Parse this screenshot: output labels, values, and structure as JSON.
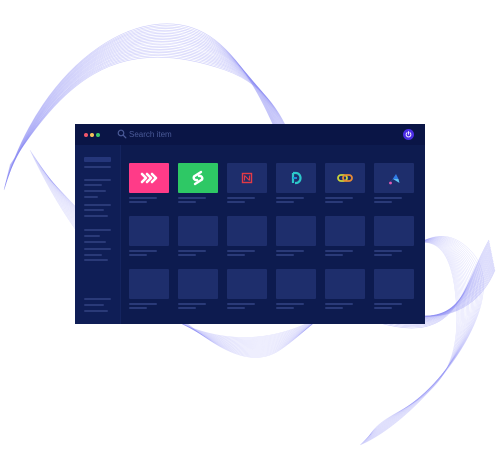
{
  "titlebar": {
    "dots": [
      {
        "name": "close",
        "color": "#f0556a"
      },
      {
        "name": "minimize",
        "color": "#f5c15a"
      },
      {
        "name": "maximize",
        "color": "#39c96b"
      }
    ]
  },
  "search": {
    "placeholder": "Search item",
    "icon": "search-icon"
  },
  "power": {
    "icon": "power-icon",
    "color": "#4b2de6"
  },
  "apps": [
    {
      "id": "app-pink-chevrons",
      "icon": "triple-chevron-icon",
      "bg": "#ff3b88"
    },
    {
      "id": "app-green-link",
      "icon": "link-s-icon",
      "bg": "#2ec865"
    },
    {
      "id": "app-red-frame",
      "icon": "red-frame-icon",
      "bg": "#1e2e6c"
    },
    {
      "id": "app-teal-d",
      "icon": "teal-d-icon",
      "bg": "#1e2e6c"
    },
    {
      "id": "app-chain",
      "icon": "chain-icon",
      "bg": "#1e2e6c"
    },
    {
      "id": "app-blue-arrow",
      "icon": "blue-arrow-icon",
      "bg": "#1e2e6c"
    }
  ],
  "colors": {
    "window_bg": "#0d1b4f",
    "titlebar_bg": "#0a1546",
    "placeholder_tile": "#1e2e6c",
    "wave_stroke": "#8f8ef5"
  }
}
